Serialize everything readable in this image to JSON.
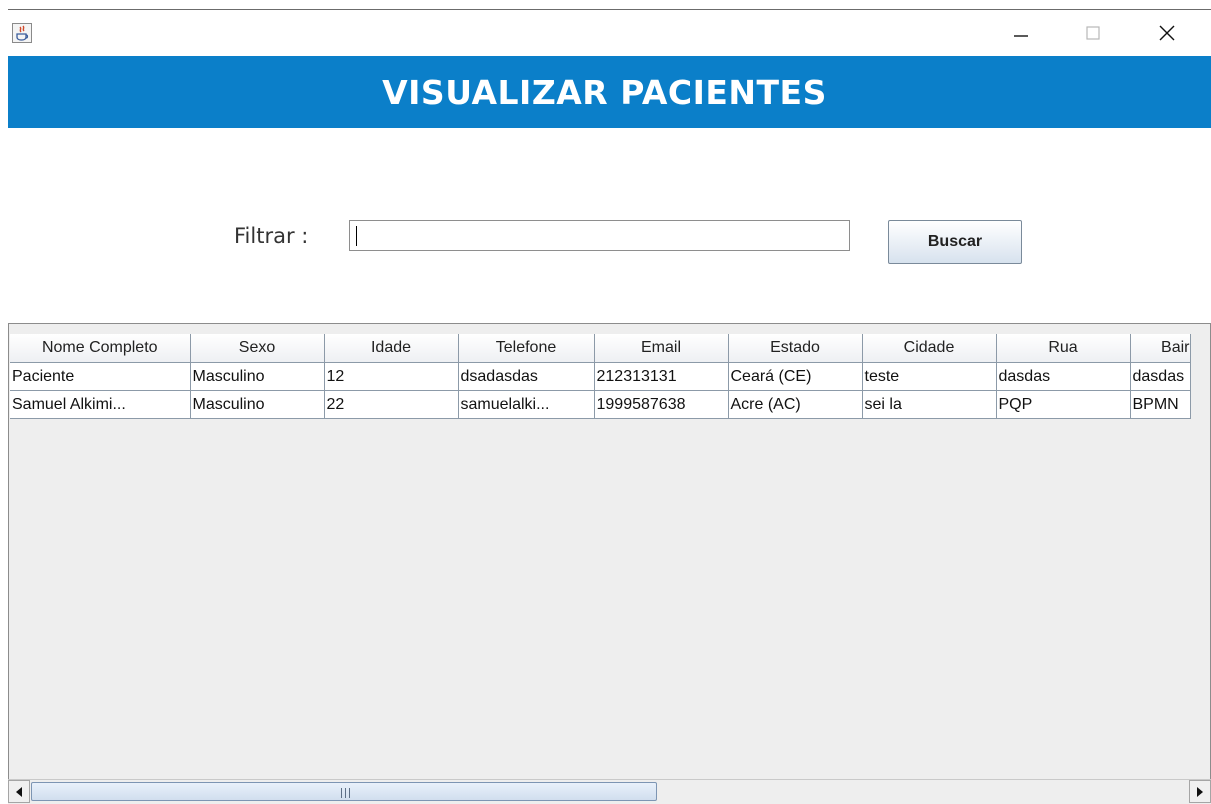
{
  "window": {
    "min_glyph": "—",
    "max_glyph": "☐",
    "close_glyph": "✕"
  },
  "header": {
    "title": "VISUALIZAR PACIENTES"
  },
  "filter": {
    "label": "Filtrar :",
    "value": "",
    "button": "Buscar"
  },
  "table": {
    "columns": [
      "Nome Completo",
      "Sexo",
      "Idade",
      "Telefone",
      "Email",
      "Estado",
      "Cidade",
      "Rua",
      "Bair"
    ],
    "rows": [
      [
        "Paciente",
        "Masculino",
        "12",
        "dsadasdas",
        "212313131",
        "Ceará (CE)",
        "teste",
        "dasdas",
        "dasdas"
      ],
      [
        "Samuel Alkimi...",
        "Masculino",
        "22",
        "samuelalki...",
        "1999587638",
        "Acre (AC)",
        "sei la",
        "PQP",
        "BPMN"
      ]
    ]
  },
  "colors": {
    "header_bg": "#0b7fc9",
    "header_text": "#ffffff"
  }
}
